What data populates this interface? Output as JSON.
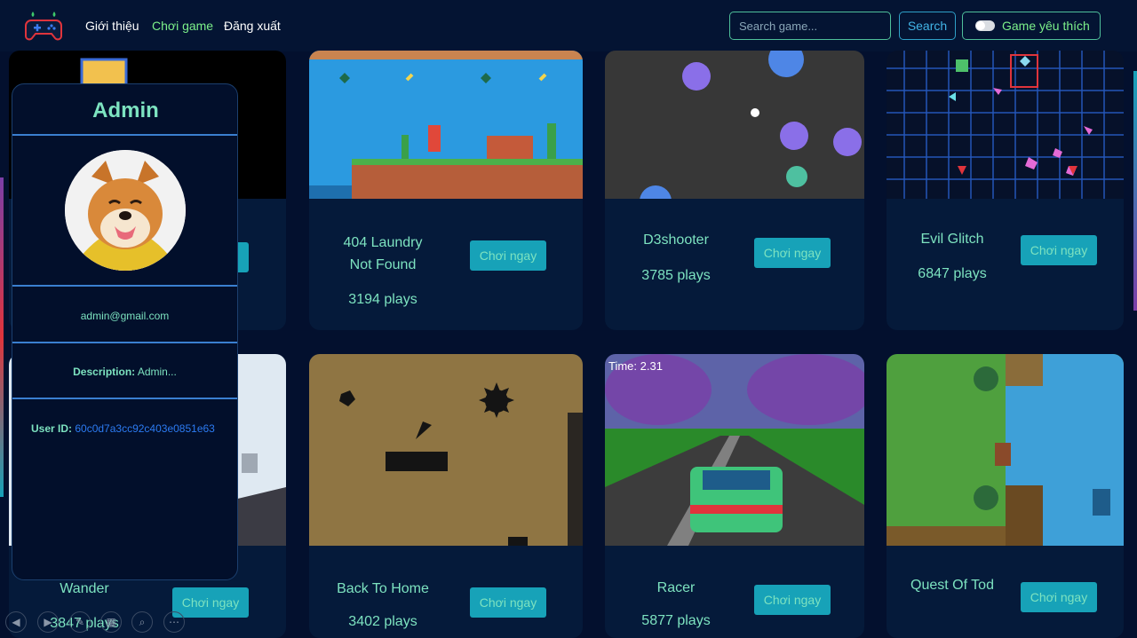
{
  "nav": {
    "links": [
      "Giới thiệu",
      "Chơi game",
      "Đăng xuất"
    ],
    "search_placeholder": "Search game...",
    "search_button": "Search",
    "favorite_toggle": "Game yêu thích"
  },
  "profile": {
    "name": "Admin",
    "email": "admin@gmail.com",
    "description_label": "Description:",
    "description_value": "Admin...",
    "user_id_label": "User ID:",
    "user_id_value": "60c0d7a3cc92c403e0851e63"
  },
  "games": [
    {
      "title": "404 Laundry Not Found",
      "plays": "3194 plays",
      "button": "Chơi ngay"
    },
    {
      "title": "D3shooter",
      "plays": "3785 plays",
      "button": "Chơi ngay"
    },
    {
      "title": "Evil Glitch",
      "plays": "6847 plays",
      "button": "Chơi ngay"
    },
    {
      "title": "Wander",
      "plays": "3847 plays",
      "button": "Chơi ngay"
    },
    {
      "title": "Back To Home",
      "plays": "3402 plays",
      "button": "Chơi ngay"
    },
    {
      "title": "Racer",
      "plays": "5877 plays",
      "button": "Chơi ngay"
    },
    {
      "title": "Quest Of Tod",
      "plays": "",
      "button": "Chơi ngay"
    }
  ],
  "racer_hud": "Time: 2.31",
  "colors": {
    "background": "#03102e",
    "card": "#051a3a",
    "accent": "#7de3c0",
    "button": "#17a2b8",
    "link_active": "#7cf08a"
  }
}
